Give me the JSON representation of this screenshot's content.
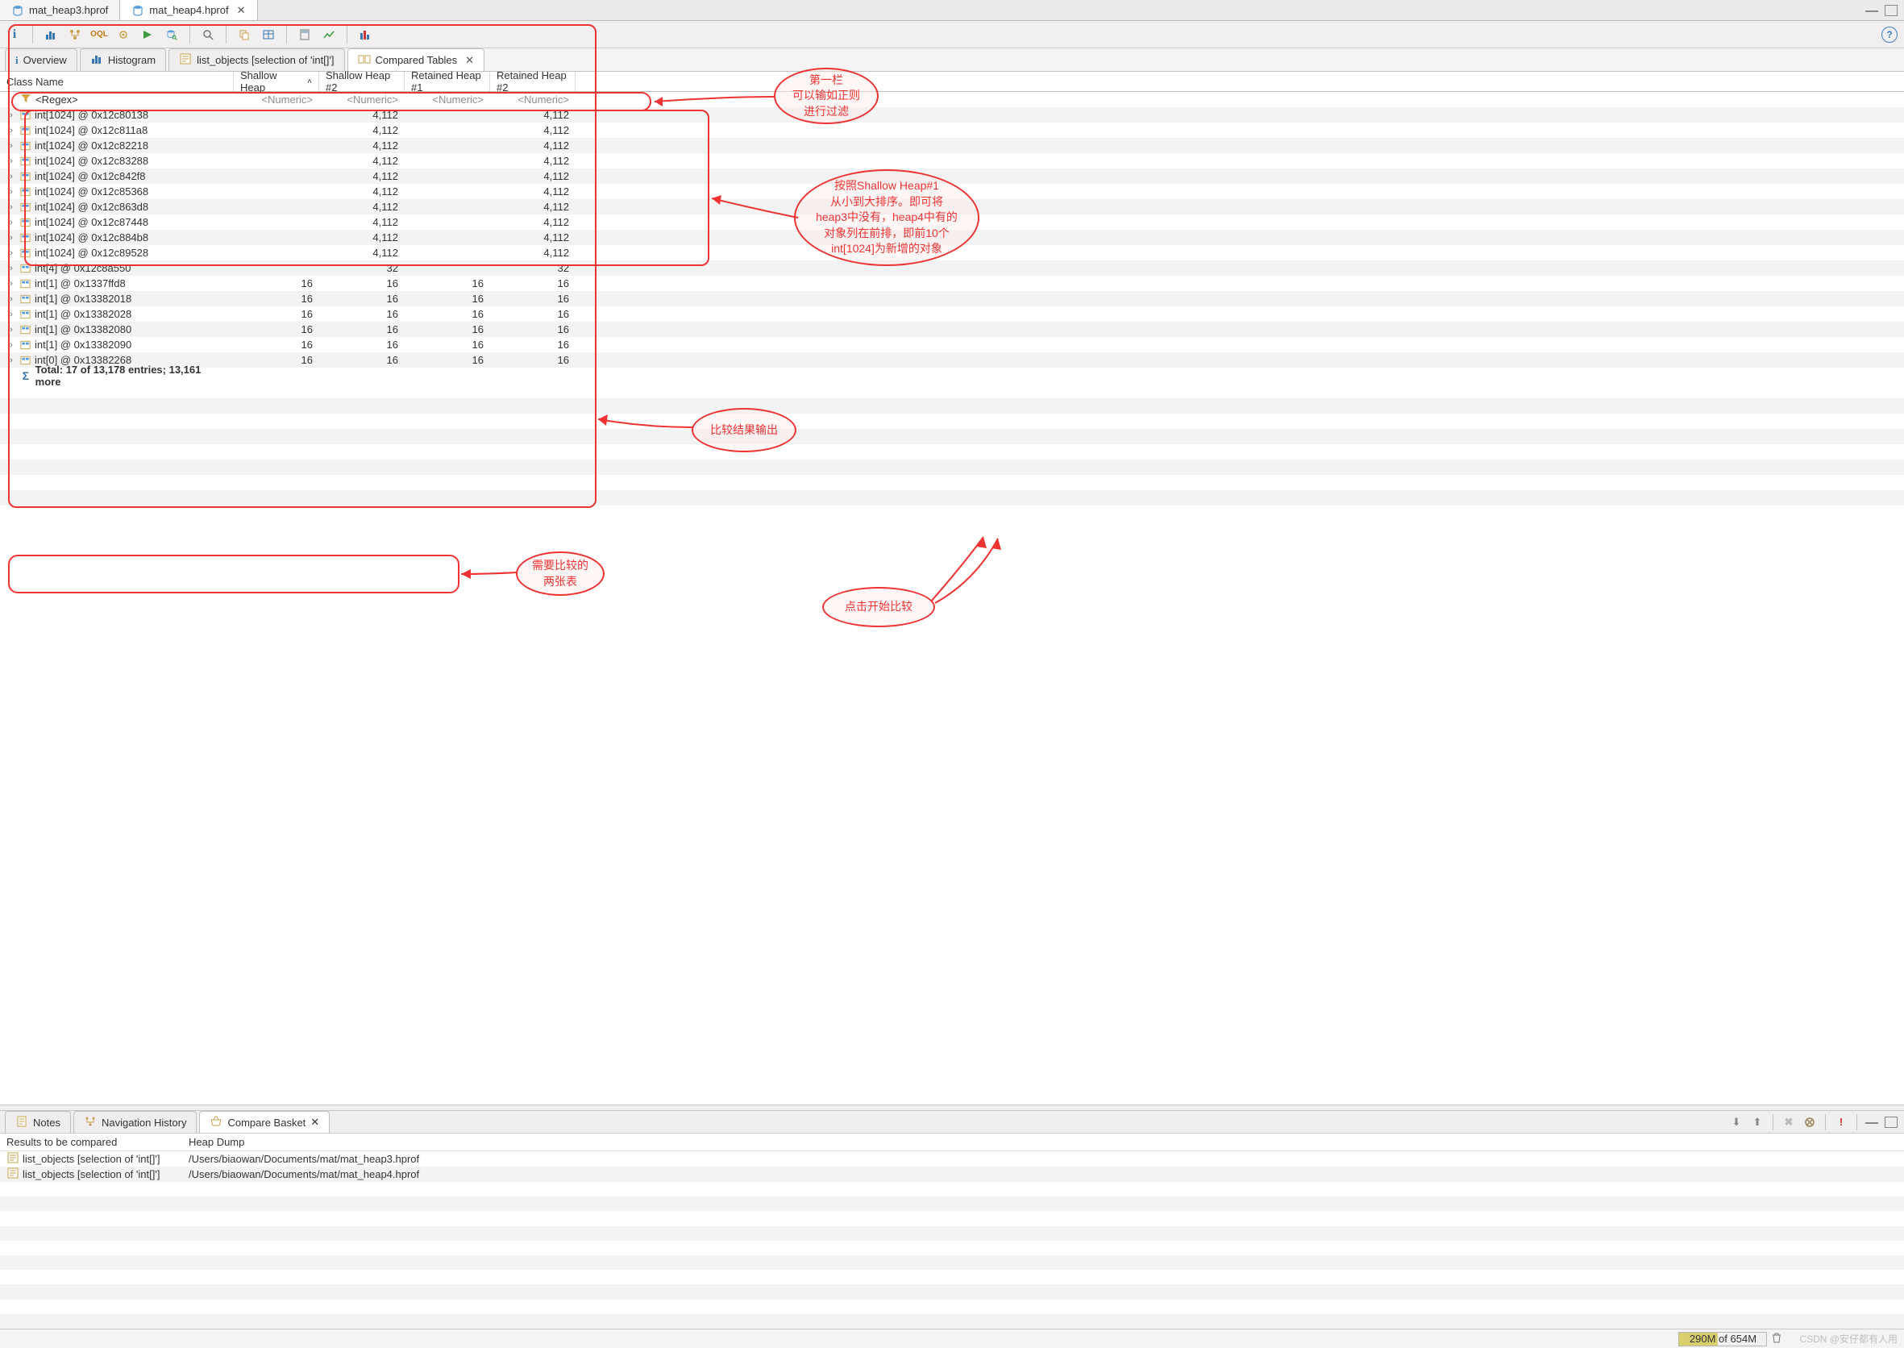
{
  "file_tabs": [
    {
      "label": "mat_heap3.hprof",
      "active": false
    },
    {
      "label": "mat_heap4.hprof",
      "active": true
    }
  ],
  "toolbar_icons": [
    "info-icon",
    "histogram-icon",
    "tree-icon",
    "oql-icon",
    "gear-icon",
    "run-icon",
    "database-icon",
    "search-icon",
    "copy-icon",
    "table-icon",
    "calc-icon",
    "chart-icon",
    "bars-icon"
  ],
  "view_tabs": [
    {
      "icon": "info-icon",
      "label": "Overview",
      "active": false,
      "closable": false
    },
    {
      "icon": "histogram-icon",
      "label": "Histogram",
      "active": false,
      "closable": false
    },
    {
      "icon": "query-icon",
      "label": "list_objects [selection of 'int[]']",
      "active": false,
      "closable": false
    },
    {
      "icon": "compare-icon",
      "label": "Compared Tables",
      "active": true,
      "closable": true
    }
  ],
  "columns": [
    {
      "label": "Class Name",
      "sort": ""
    },
    {
      "label": "Shallow Heap",
      "sort": "asc"
    },
    {
      "label": "Shallow Heap #2",
      "sort": ""
    },
    {
      "label": "Retained Heap #1",
      "sort": ""
    },
    {
      "label": "Retained Heap #2",
      "sort": ""
    }
  ],
  "filter_row": {
    "name_placeholder": "<Regex>",
    "numeric_placeholder": "<Numeric>"
  },
  "rows": [
    {
      "name": "int[1024] @ 0x12c80138",
      "sh1": "",
      "sh2": "4,112",
      "rh1": "",
      "rh2": "4,112"
    },
    {
      "name": "int[1024] @ 0x12c811a8",
      "sh1": "",
      "sh2": "4,112",
      "rh1": "",
      "rh2": "4,112"
    },
    {
      "name": "int[1024] @ 0x12c82218",
      "sh1": "",
      "sh2": "4,112",
      "rh1": "",
      "rh2": "4,112"
    },
    {
      "name": "int[1024] @ 0x12c83288",
      "sh1": "",
      "sh2": "4,112",
      "rh1": "",
      "rh2": "4,112"
    },
    {
      "name": "int[1024] @ 0x12c842f8",
      "sh1": "",
      "sh2": "4,112",
      "rh1": "",
      "rh2": "4,112"
    },
    {
      "name": "int[1024] @ 0x12c85368",
      "sh1": "",
      "sh2": "4,112",
      "rh1": "",
      "rh2": "4,112"
    },
    {
      "name": "int[1024] @ 0x12c863d8",
      "sh1": "",
      "sh2": "4,112",
      "rh1": "",
      "rh2": "4,112"
    },
    {
      "name": "int[1024] @ 0x12c87448",
      "sh1": "",
      "sh2": "4,112",
      "rh1": "",
      "rh2": "4,112"
    },
    {
      "name": "int[1024] @ 0x12c884b8",
      "sh1": "",
      "sh2": "4,112",
      "rh1": "",
      "rh2": "4,112"
    },
    {
      "name": "int[1024] @ 0x12c89528",
      "sh1": "",
      "sh2": "4,112",
      "rh1": "",
      "rh2": "4,112"
    },
    {
      "name": "int[4] @ 0x12c8a550",
      "sh1": "",
      "sh2": "32",
      "rh1": "",
      "rh2": "32"
    },
    {
      "name": "int[1] @ 0x1337ffd8",
      "sh1": "16",
      "sh2": "16",
      "rh1": "16",
      "rh2": "16"
    },
    {
      "name": "int[1] @ 0x13382018",
      "sh1": "16",
      "sh2": "16",
      "rh1": "16",
      "rh2": "16"
    },
    {
      "name": "int[1] @ 0x13382028",
      "sh1": "16",
      "sh2": "16",
      "rh1": "16",
      "rh2": "16"
    },
    {
      "name": "int[1] @ 0x13382080",
      "sh1": "16",
      "sh2": "16",
      "rh1": "16",
      "rh2": "16"
    },
    {
      "name": "int[1] @ 0x13382090",
      "sh1": "16",
      "sh2": "16",
      "rh1": "16",
      "rh2": "16"
    },
    {
      "name": "int[0] @ 0x13382268",
      "sh1": "16",
      "sh2": "16",
      "rh1": "16",
      "rh2": "16"
    }
  ],
  "total_row": {
    "label": "Total: 17 of 13,178 entries; 13,161 more"
  },
  "bottom_tabs": [
    {
      "icon": "notes-icon",
      "label": "Notes",
      "active": false,
      "closable": false
    },
    {
      "icon": "nav-icon",
      "label": "Navigation History",
      "active": false,
      "closable": false
    },
    {
      "icon": "basket-icon",
      "label": "Compare Basket",
      "active": true,
      "closable": true
    }
  ],
  "compare_header": {
    "col1": "Results to be compared",
    "col2": "Heap Dump"
  },
  "compare_rows": [
    {
      "name": "list_objects [selection of 'int[]']",
      "path": "/Users/biaowan/Documents/mat/mat_heap3.hprof"
    },
    {
      "name": "list_objects [selection of 'int[]']",
      "path": "/Users/biaowan/Documents/mat/mat_heap4.hprof"
    }
  ],
  "memory": {
    "used": "290M",
    "of": "of",
    "total": "654M",
    "pct": 44
  },
  "watermark": "CSDN @安仔都有人用",
  "callouts": {
    "regex": "第一栏\n可以输如正则\n进行过滤",
    "sort": "按照Shallow Heap#1\n从小到大排序。即可将\nheap3中没有，heap4中有的\n对象列在前排，即前10个\nint[1024]为新增的对象",
    "output": "比较结果输出",
    "tables": "需要比较的\n两张表",
    "compare": "点击开始比较"
  }
}
